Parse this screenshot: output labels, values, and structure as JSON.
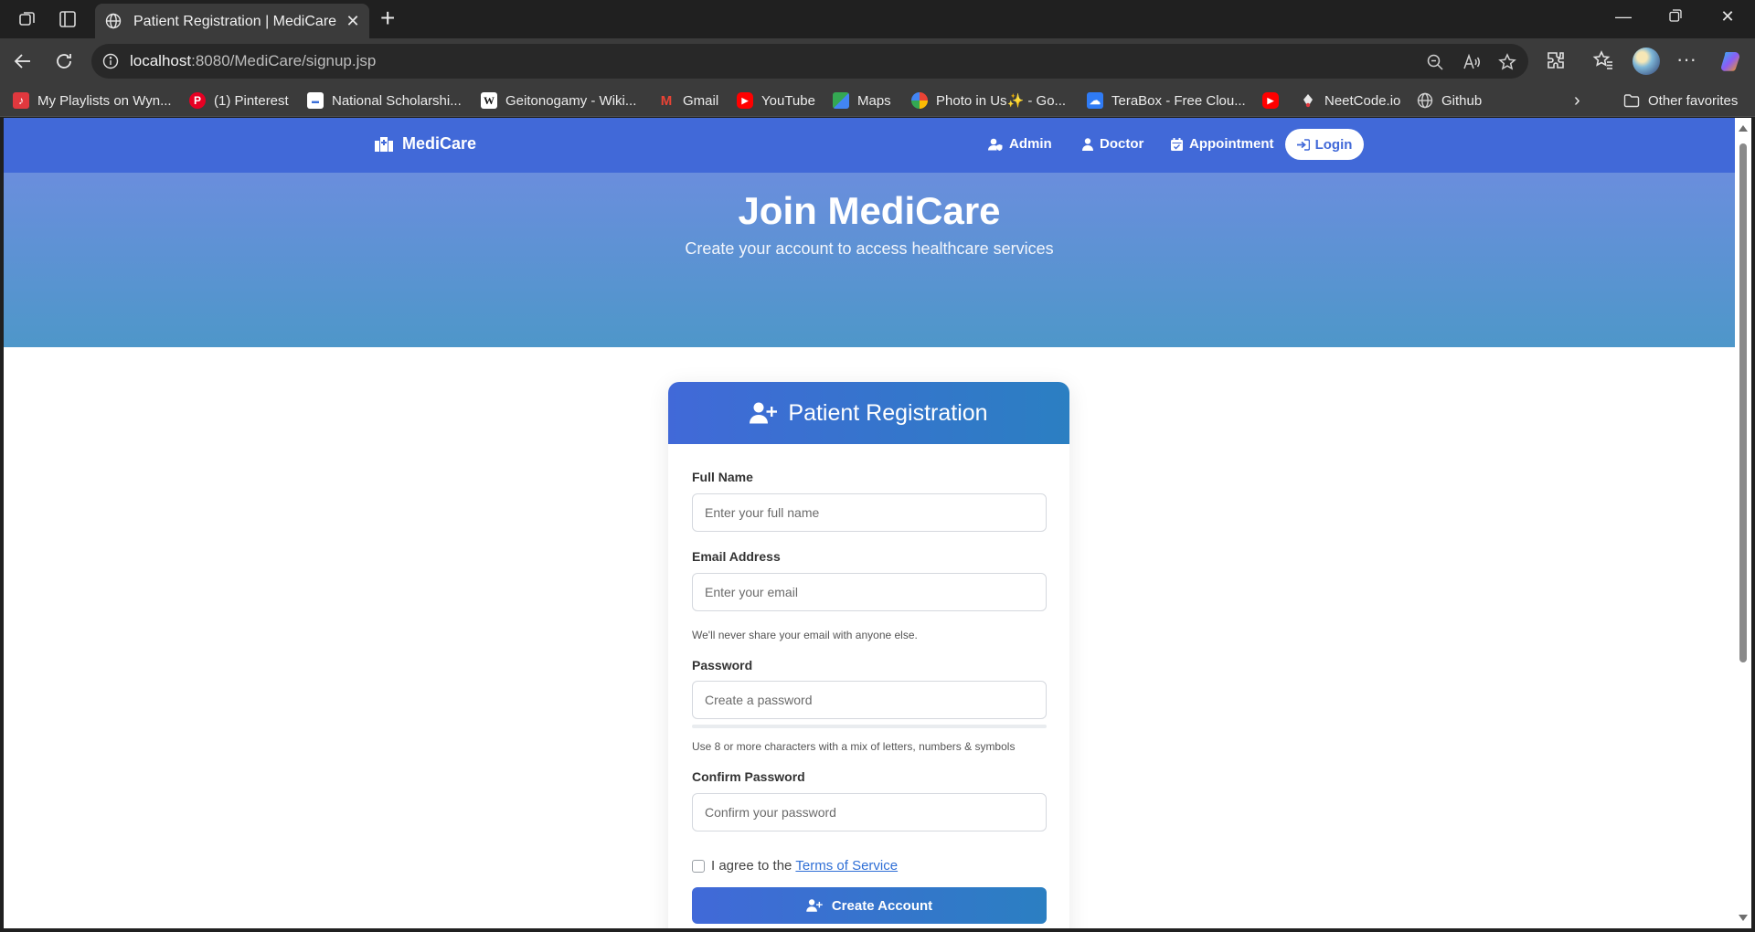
{
  "browser": {
    "tab_title": "Patient Registration | MediCare",
    "url_host": "localhost",
    "url_rest": ":8080/MediCare/signup.jsp",
    "bookmarks": [
      {
        "label": "My Playlists on Wyn...",
        "icon": "wynk-icon",
        "color": "#e0383e"
      },
      {
        "label": "(1) Pinterest",
        "icon": "pinterest-icon",
        "color": "#e60023"
      },
      {
        "label": "National Scholarshi...",
        "icon": "nsp-icon",
        "color": "#3b6fd8"
      },
      {
        "label": "Geitonogamy - Wiki...",
        "icon": "wikipedia-icon",
        "color": "#ffffff"
      },
      {
        "label": "Gmail",
        "icon": "gmail-icon",
        "color": "#ea4335"
      },
      {
        "label": "YouTube",
        "icon": "youtube-icon",
        "color": "#ff0000"
      },
      {
        "label": "Maps",
        "icon": "maps-icon",
        "color": "#34a853"
      },
      {
        "label": "Photo in Us✨ - Go...",
        "icon": "google-photos-icon",
        "color": "#fbbc04"
      },
      {
        "label": "TeraBox - Free Clou...",
        "icon": "terabox-icon",
        "color": "#2f7bf5"
      },
      {
        "label": "",
        "icon": "youtube-icon",
        "color": "#ff0000"
      },
      {
        "label": "NeetCode.io",
        "icon": "neetcode-icon",
        "color": "#2e7d32"
      },
      {
        "label": "Github",
        "icon": "globe-icon",
        "color": "#cfcfcf"
      }
    ],
    "other_favorites": "Other favorites"
  },
  "site": {
    "brand": "MediCare",
    "nav": {
      "admin": "Admin",
      "doctor": "Doctor",
      "appointment": "Appointment",
      "login": "Login"
    },
    "accent": "#4169d8"
  },
  "hero": {
    "title": "Join MediCare",
    "subtitle": "Create your account to access healthcare services"
  },
  "form": {
    "heading": "Patient Registration",
    "full_name": {
      "label": "Full Name",
      "placeholder": "Enter your full name",
      "value": ""
    },
    "email": {
      "label": "Email Address",
      "placeholder": "Enter your email",
      "value": "",
      "help": "We'll never share your email with anyone else."
    },
    "password": {
      "label": "Password",
      "placeholder": "Create a password",
      "value": "",
      "help": "Use 8 or more characters with a mix of letters, numbers & symbols"
    },
    "confirm_password": {
      "label": "Confirm Password",
      "placeholder": "Confirm your password",
      "value": ""
    },
    "agree_text": "I agree to the",
    "terms_link": "Terms of Service",
    "terms_checked": false,
    "submit": "Create Account"
  }
}
